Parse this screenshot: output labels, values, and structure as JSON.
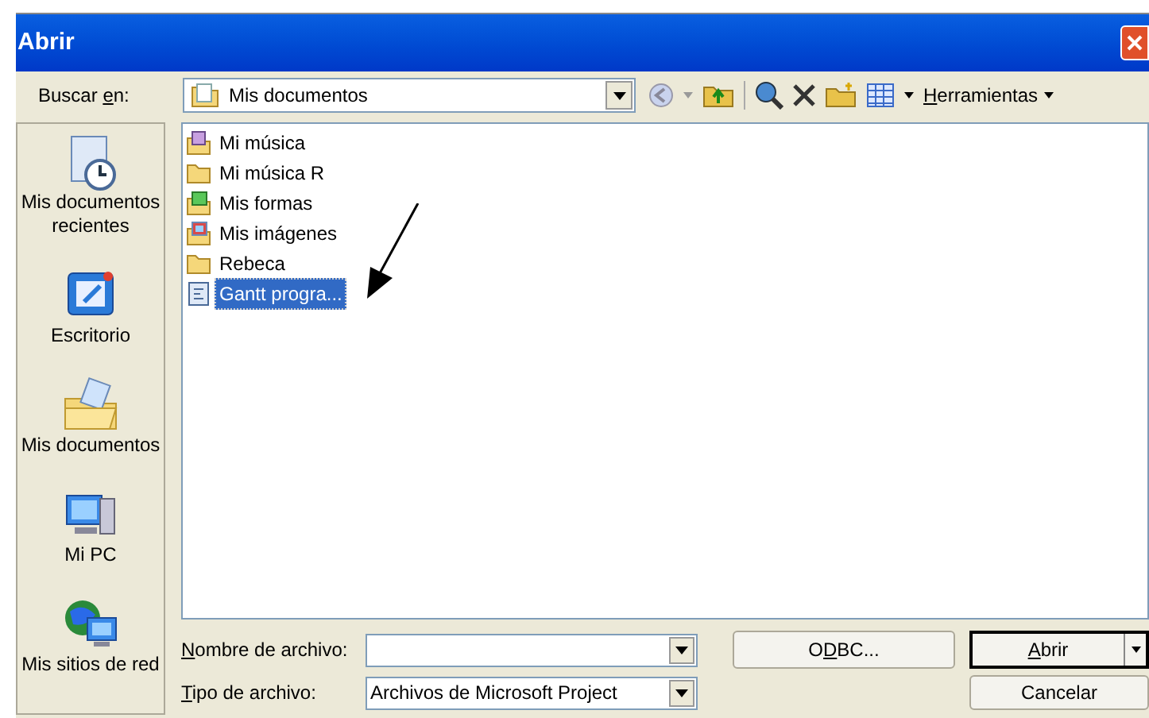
{
  "window": {
    "title": "Abrir"
  },
  "toolbar": {
    "look_in_label": {
      "pre": "Buscar ",
      "key": "e",
      "post": "n:"
    },
    "look_in_value": "Mis documentos",
    "tools_menu": {
      "key": "H",
      "post": "erramientas"
    }
  },
  "places": [
    {
      "label": "Mis documentos recientes",
      "kind": "recent"
    },
    {
      "label": "Escritorio",
      "kind": "desktop"
    },
    {
      "label": "Mis documentos",
      "kind": "documents"
    },
    {
      "label": "Mi PC",
      "kind": "computer"
    },
    {
      "label": "Mis sitios de red",
      "kind": "network"
    }
  ],
  "files": [
    {
      "name": "Mi música",
      "kind": "music",
      "selected": false
    },
    {
      "name": "Mi música R",
      "kind": "folder",
      "selected": false
    },
    {
      "name": "Mis formas",
      "kind": "shapes",
      "selected": false
    },
    {
      "name": "Mis imágenes",
      "kind": "pictures",
      "selected": false
    },
    {
      "name": "Rebeca",
      "kind": "folder",
      "selected": false
    },
    {
      "name": "Gantt progra...",
      "kind": "project",
      "selected": true
    }
  ],
  "file_name": {
    "label": {
      "key": "N",
      "post": "ombre de archivo:"
    }
  },
  "file_type": {
    "label": {
      "key": "T",
      "post": "ipo de archivo:"
    },
    "value": "Archivos de Microsoft Project"
  },
  "buttons": {
    "odbc": {
      "pre": "O",
      "key": "D",
      "post": "BC..."
    },
    "open": {
      "key": "A",
      "post": "brir"
    },
    "cancel": "Cancelar"
  }
}
